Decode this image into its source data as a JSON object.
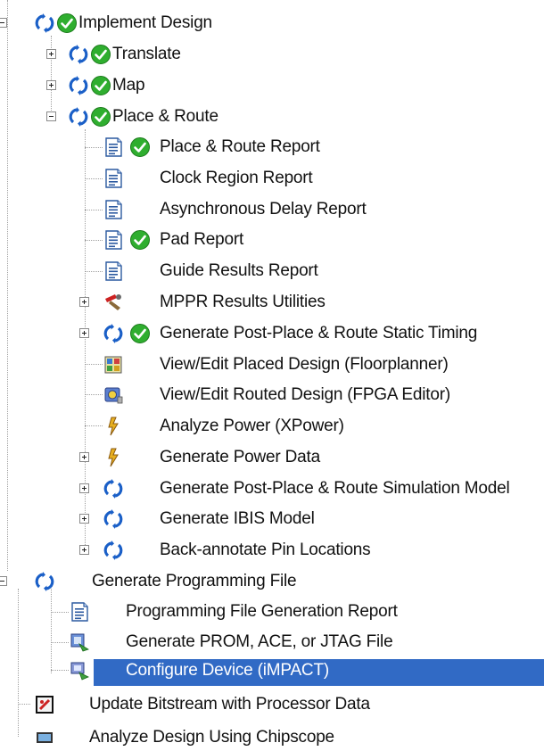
{
  "tree": {
    "implement_design": "Implement Design",
    "translate": "Translate",
    "map": "Map",
    "place_route": "Place & Route",
    "place_route_report": "Place & Route Report",
    "clock_region_report": "Clock Region Report",
    "async_delay_report": "Asynchronous Delay Report",
    "pad_report": "Pad Report",
    "guide_results_report": "Guide Results Report",
    "mppr_results_utilities": "MPPR Results Utilities",
    "gen_post_par_static_timing": "Generate Post-Place & Route Static Timing",
    "view_edit_placed_design": "View/Edit Placed Design (Floorplanner)",
    "view_edit_routed_design": "View/Edit Routed Design (FPGA Editor)",
    "analyze_power": "Analyze Power (XPower)",
    "generate_power_data": "Generate Power Data",
    "gen_post_par_sim_model": "Generate Post-Place & Route Simulation Model",
    "generate_ibis_model": "Generate IBIS Model",
    "back_annotate_pin_locations": "Back-annotate Pin Locations",
    "generate_programming_file": "Generate Programming File",
    "programming_file_gen_report": "Programming File Generation Report",
    "generate_prom_ace_jtag": "Generate PROM, ACE, or JTAG File",
    "configure_device": "Configure Device (iMPACT)",
    "update_bitstream": "Update Bitstream with Processor Data",
    "analyze_design_chipscope": "Analyze Design Using Chipscope"
  },
  "colors": {
    "selection": "#316ac5",
    "check_green": "#2fae2f",
    "rerun_blue": "#1a5fc7"
  }
}
